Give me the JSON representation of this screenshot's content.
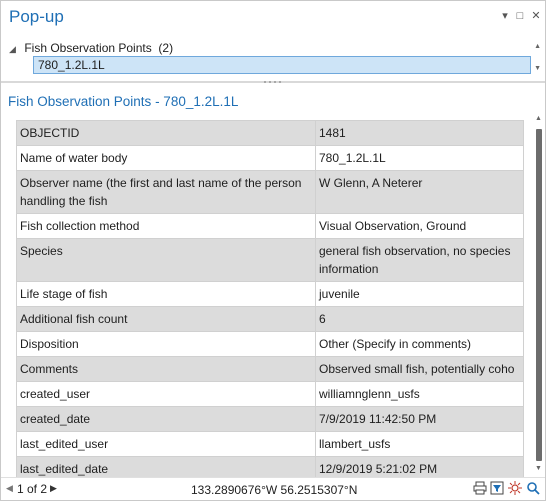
{
  "window": {
    "title": "Pop-up",
    "controls": {
      "menu": "▾",
      "maximize": "□",
      "close": "✕"
    }
  },
  "tree": {
    "layer_label": "Fish Observation Points",
    "layer_count": "(2)",
    "selected_feature": "780_1.2L.1L"
  },
  "section_title": "Fish Observation Points - 780_1.2L.1L",
  "attributes": [
    {
      "field": "OBJECTID",
      "value": "1481"
    },
    {
      "field": "Name of water body",
      "value": "780_1.2L.1L"
    },
    {
      "field": "Observer name (the first and last name of the person handling the fish",
      "value": "W Glenn, A Neterer"
    },
    {
      "field": "Fish collection method",
      "value": "Visual Observation, Ground"
    },
    {
      "field": "Species",
      "value": "general fish observation, no species information"
    },
    {
      "field": "Life stage of fish",
      "value": "juvenile"
    },
    {
      "field": "Additional fish count",
      "value": "6"
    },
    {
      "field": "Disposition",
      "value": "Other (Specify in comments)"
    },
    {
      "field": "Comments",
      "value": "Observed small fish, potentially coho"
    },
    {
      "field": "created_user",
      "value": "williamnglenn_usfs"
    },
    {
      "field": "created_date",
      "value": "7/9/2019 11:42:50 PM"
    },
    {
      "field": "last_edited_user",
      "value": "llambert_usfs"
    },
    {
      "field": "last_edited_date",
      "value": "12/9/2019 5:21:02 PM"
    }
  ],
  "status": {
    "pager": "1 of 2",
    "coordinates": "133.2890676°W 56.2515307°N"
  },
  "icons": {
    "print": "printer-icon",
    "filter": "filter-icon",
    "flash": "flash-icon",
    "zoom": "zoom-to-icon"
  },
  "colors": {
    "accent": "#1f6fb5",
    "selection": "#cde4f7",
    "row_shade": "#dcdcdc"
  }
}
